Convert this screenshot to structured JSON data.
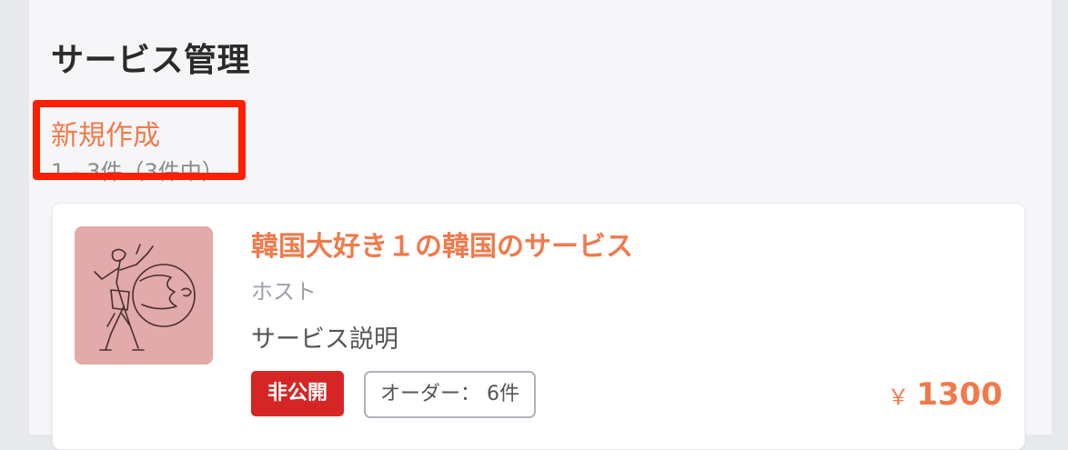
{
  "page": {
    "title": "サービス管理",
    "new_link": "新規作成",
    "count_text": "1 - 3件（3件中）"
  },
  "service": {
    "title": "韓国大好き１の韓国のサービス",
    "host": "ホスト",
    "description": "サービス説明",
    "status_badge": "非公開",
    "orders_badge": "オーダー： 6件",
    "price_symbol": "￥",
    "price": "1300"
  },
  "colors": {
    "accent": "#f07a4b",
    "status_private": "#d62525",
    "highlight": "#ff1e00"
  }
}
